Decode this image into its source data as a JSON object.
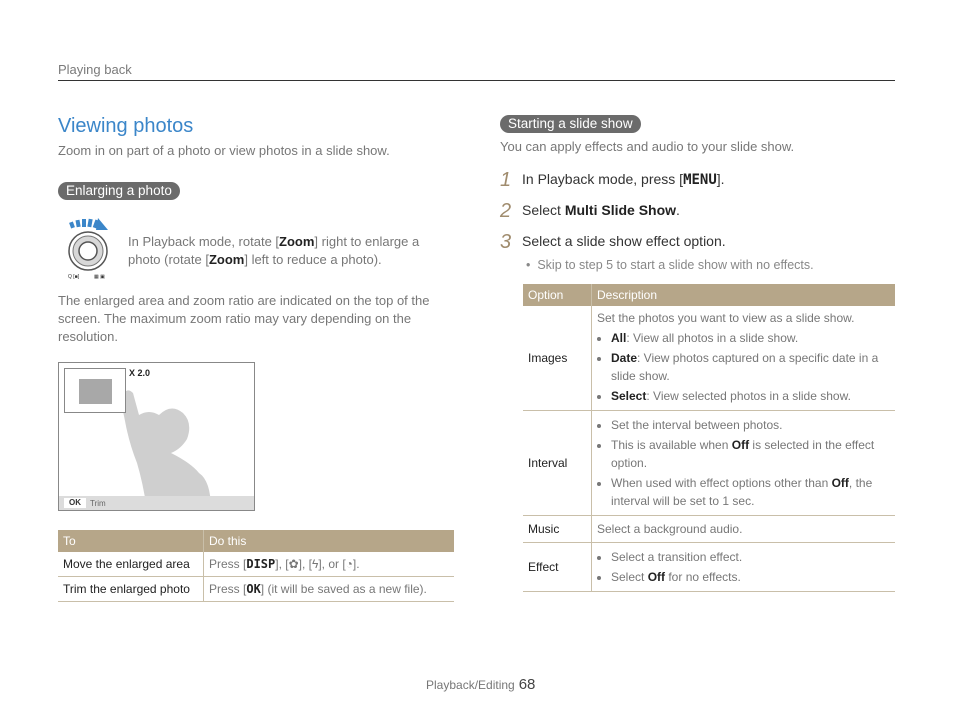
{
  "header": {
    "running_head": "Playing back"
  },
  "left": {
    "title": "Viewing photos",
    "subtitle": "Zoom in on part of a photo or view photos in a slide show.",
    "section_label": "Enlarging a photo",
    "zoom_instruction": {
      "pre1": "In Playback mode, rotate [",
      "key1": "Zoom",
      "mid": "] right to enlarge a photo (rotate [",
      "key2": "Zoom",
      "post": "] left to reduce a photo)."
    },
    "paragraph": "The enlarged area and zoom ratio are indicated on the top of the screen. The maximum zoom ratio may vary depending on the resolution.",
    "screen": {
      "zoom_ratio": "X 2.0",
      "ok_key": "OK",
      "ok_label": "Trim"
    },
    "table": {
      "headers": [
        "To",
        "Do this"
      ],
      "rows": [
        {
          "to": "Move the enlarged area",
          "pre": "Press [",
          "keys": "DISP",
          "post": "], [✿], [ϟ], or [◔]."
        },
        {
          "to": "Trim the enlarged photo",
          "pre": "Press [",
          "keys": "OK",
          "post": "] (it will be saved as a new file)."
        }
      ]
    }
  },
  "right": {
    "section_label": "Starting a slide show",
    "lead": "You can apply effects and audio to your slide show.",
    "steps": [
      {
        "num": "1",
        "pre": "In Playback mode, press [",
        "key": "MENU",
        "post": "]."
      },
      {
        "num": "2",
        "pre": "Select ",
        "key": "Multi Slide Show",
        "post": "."
      },
      {
        "num": "3",
        "pre": "Select a slide show effect option.",
        "key": "",
        "post": ""
      }
    ],
    "step_note": "Skip to step 5 to start a slide show with no effects.",
    "table": {
      "headers": [
        "Option",
        "Description"
      ],
      "rows": [
        {
          "option": "Images",
          "intro": "Set the photos you want to view as a slide show.",
          "bullets": [
            {
              "b": "All",
              "t": ": View all photos in a slide show."
            },
            {
              "b": "Date",
              "t": ": View photos captured on a specific date in a slide show."
            },
            {
              "b": "Select",
              "t": ": View selected photos in a slide show."
            }
          ]
        },
        {
          "option": "Interval",
          "bullets": [
            {
              "t": "Set the interval between photos."
            },
            {
              "t1": "This is available when ",
              "b": "Off",
              "t2": " is selected in the effect option."
            },
            {
              "t1": "When used with effect options other than ",
              "b": "Off",
              "t2": ", the interval will be set to 1 sec."
            }
          ]
        },
        {
          "option": "Music",
          "text": "Select a background audio."
        },
        {
          "option": "Effect",
          "bullets": [
            {
              "t": "Select a transition effect."
            },
            {
              "t1": "Select ",
              "b": "Off",
              "t2": " for no effects."
            }
          ]
        }
      ]
    }
  },
  "footer": {
    "section": "Playback/Editing",
    "page": "68"
  }
}
